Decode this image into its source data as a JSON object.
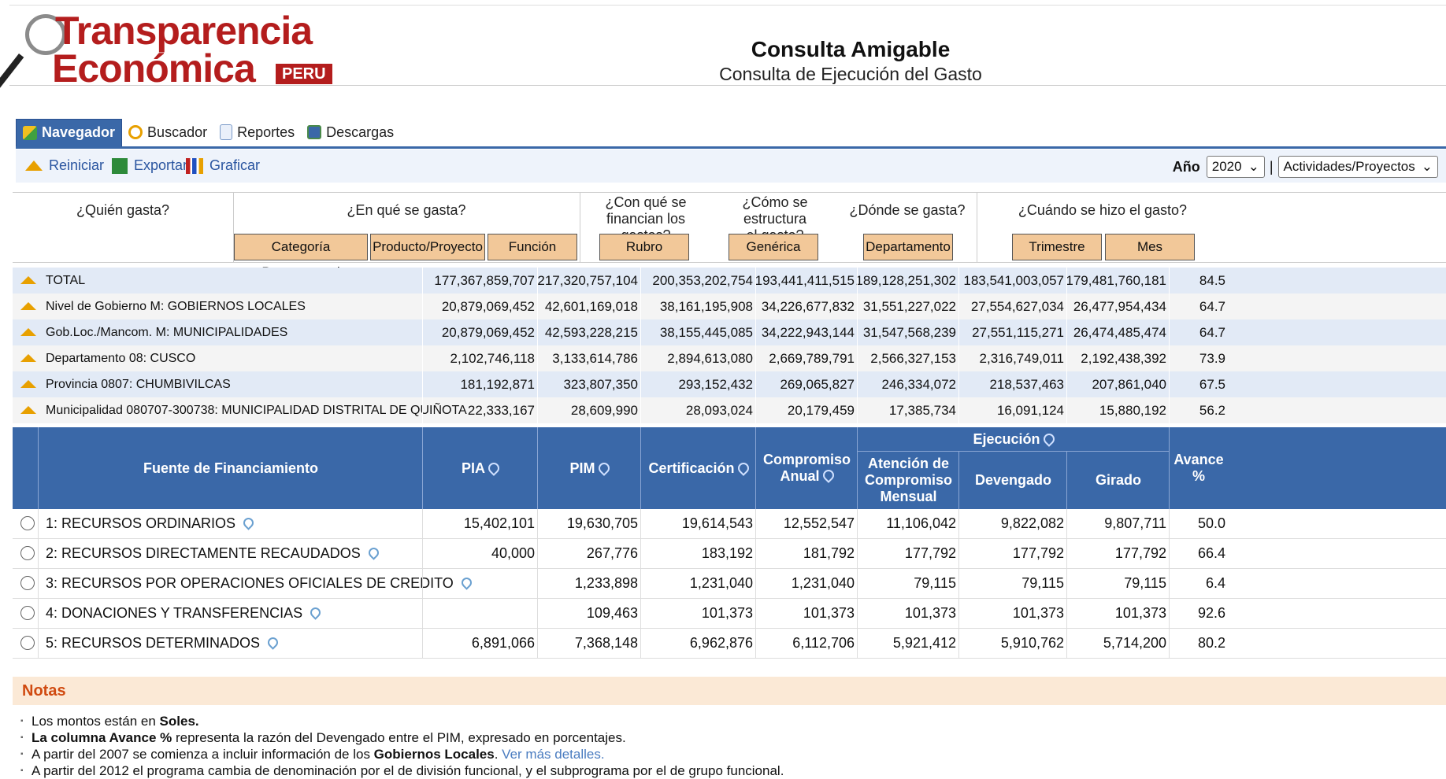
{
  "header": {
    "logo_line1": "Transparencia",
    "logo_line2": "Económica",
    "logo_badge": "PERU",
    "title": "Consulta Amigable",
    "subtitle": "Consulta de Ejecución del Gasto"
  },
  "tabs": [
    "Navegador",
    "Buscador",
    "Reportes",
    "Descargas"
  ],
  "toolbar": {
    "reiniciar": "Reiniciar",
    "exportar": "Exportar",
    "graficar": "Graficar",
    "anio_label": "Año",
    "anio_value": "2020",
    "sep": "|",
    "tipo_value": "Actividades/Proyectos"
  },
  "filters": {
    "q_quien": "¿Quién gasta?",
    "q_enque": "¿En qué se gasta?",
    "q_conque_1": "¿Con qué se",
    "q_conque_2": "financian los gastos?",
    "q_como_1": "¿Cómo se estructura",
    "q_como_2": "el gasto?",
    "q_donde": "¿Dónde se gasta?",
    "q_cuando": "¿Cuándo se hizo el gasto?",
    "b_categoria": "Categoría Presupuestal",
    "b_producto": "Producto/Proyecto",
    "b_funcion": "Función",
    "b_rubro": "Rubro",
    "b_generica": "Genérica",
    "b_departamento": "Departamento",
    "b_trimestre": "Trimestre",
    "b_mes": "Mes"
  },
  "summary": [
    {
      "label": "TOTAL",
      "pia": "177,367,859,707",
      "pim": "217,320,757,104",
      "cert": "200,353,202,754",
      "comp_anual": "193,441,411,515",
      "atencion": "189,128,251,302",
      "devengado": "183,541,003,057",
      "girado": "179,481,760,181",
      "avance": "84.5"
    },
    {
      "label": "Nivel de Gobierno M: GOBIERNOS LOCALES",
      "pia": "20,879,069,452",
      "pim": "42,601,169,018",
      "cert": "38,161,195,908",
      "comp_anual": "34,226,677,832",
      "atencion": "31,551,227,022",
      "devengado": "27,554,627,034",
      "girado": "26,477,954,434",
      "avance": "64.7"
    },
    {
      "label": "Gob.Loc./Mancom. M: MUNICIPALIDADES",
      "pia": "20,879,069,452",
      "pim": "42,593,228,215",
      "cert": "38,155,445,085",
      "comp_anual": "34,222,943,144",
      "atencion": "31,547,568,239",
      "devengado": "27,551,115,271",
      "girado": "26,474,485,474",
      "avance": "64.7"
    },
    {
      "label": "Departamento 08: CUSCO",
      "pia": "2,102,746,118",
      "pim": "3,133,614,786",
      "cert": "2,894,613,080",
      "comp_anual": "2,669,789,791",
      "atencion": "2,566,327,153",
      "devengado": "2,316,749,011",
      "girado": "2,192,438,392",
      "avance": "73.9"
    },
    {
      "label": "Provincia 0807: CHUMBIVILCAS",
      "pia": "181,192,871",
      "pim": "323,807,350",
      "cert": "293,152,432",
      "comp_anual": "269,065,827",
      "atencion": "246,334,072",
      "devengado": "218,537,463",
      "girado": "207,861,040",
      "avance": "67.5"
    },
    {
      "label": "Municipalidad 080707-300738: MUNICIPALIDAD DISTRITAL DE QUIÑOTA",
      "pia": "22,333,167",
      "pim": "28,609,990",
      "cert": "28,093,024",
      "comp_anual": "20,179,459",
      "atencion": "17,385,734",
      "devengado": "16,091,124",
      "girado": "15,880,192",
      "avance": "56.2"
    }
  ],
  "table_header": {
    "fuente": "Fuente de Financiamiento",
    "pia": "PIA",
    "pim": "PIM",
    "cert": "Certificación",
    "comp_anual_1": "Compromiso",
    "comp_anual_2": "Anual",
    "ejecucion": "Ejecución",
    "atencion_1": "Atención de",
    "atencion_2": "Compromiso",
    "atencion_3": "Mensual",
    "devengado": "Devengado",
    "girado": "Girado",
    "avance_1": "Avance",
    "avance_2": "%"
  },
  "rows": [
    {
      "fuente": "1: RECURSOS ORDINARIOS",
      "pia": "15,402,101",
      "pim": "19,630,705",
      "cert": "19,614,543",
      "comp_anual": "12,552,547",
      "atencion": "11,106,042",
      "devengado": "9,822,082",
      "girado": "9,807,711",
      "avance": "50.0"
    },
    {
      "fuente": "2: RECURSOS DIRECTAMENTE RECAUDADOS",
      "pia": "40,000",
      "pim": "267,776",
      "cert": "183,192",
      "comp_anual": "181,792",
      "atencion": "177,792",
      "devengado": "177,792",
      "girado": "177,792",
      "avance": "66.4"
    },
    {
      "fuente": "3: RECURSOS POR OPERACIONES OFICIALES DE CREDITO",
      "pia": "",
      "pim": "1,233,898",
      "cert": "1,231,040",
      "comp_anual": "1,231,040",
      "atencion": "79,115",
      "devengado": "79,115",
      "girado": "79,115",
      "avance": "6.4"
    },
    {
      "fuente": "4: DONACIONES Y TRANSFERENCIAS",
      "pia": "",
      "pim": "109,463",
      "cert": "101,373",
      "comp_anual": "101,373",
      "atencion": "101,373",
      "devengado": "101,373",
      "girado": "101,373",
      "avance": "92.6"
    },
    {
      "fuente": "5: RECURSOS DETERMINADOS",
      "pia": "6,891,066",
      "pim": "7,368,148",
      "cert": "6,962,876",
      "comp_anual": "6,112,706",
      "atencion": "5,921,412",
      "devengado": "5,910,762",
      "girado": "5,714,200",
      "avance": "80.2"
    }
  ],
  "notas": {
    "title": "Notas",
    "n1_a": "Los montos están en ",
    "n1_b": "Soles.",
    "n2_a": "La columna Avance %",
    "n2_b": " representa la razón del Devengado entre el PIM, expresado en porcentajes.",
    "n3_a": "A partir del 2007 se comienza a incluir información de los ",
    "n3_b": "Gobiernos Locales",
    "n3_c": ". ",
    "n3_link": "Ver más detalles.",
    "n4": "A partir del 2012 el programa cambia de denominación por el de división funcional, y el subprograma por el de grupo funcional."
  }
}
